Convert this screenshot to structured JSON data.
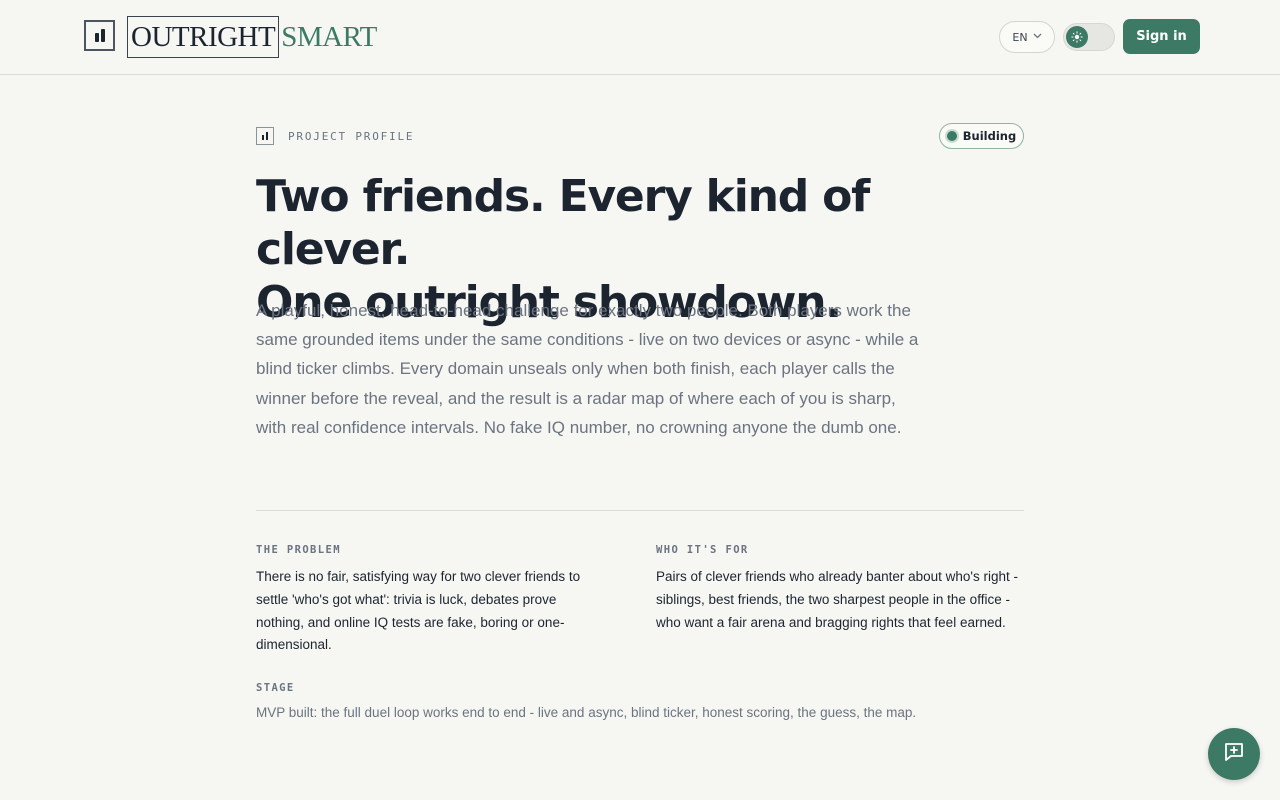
{
  "header": {
    "brand_part1_dark": "OUT",
    "brand_part1_mid": "RIGHT",
    "brand_part2": "SMART",
    "lang": "EN",
    "signin_label": "Sign in"
  },
  "profile": {
    "eyebrow": "PROJECT PROFILE",
    "status": "Building",
    "headline_line1": "Two friends. Every kind of clever.",
    "headline_line2": "One outright showdown.",
    "lede": "A playful, honest, head-to-head challenge for exactly two people. Both players work the same grounded items under the same conditions - live on two devices or async - while a blind ticker climbs. Every domain unseals only when both finish, each player calls the winner before the reveal, and the result is a radar map of where each of you is sharp, with real confidence intervals. No fake IQ number, no crowning anyone the dumb one.",
    "problem_title": "THE PROBLEM",
    "problem_text": "There is no fair, satisfying way for two clever friends to settle 'who's got what': trivia is luck, debates prove nothing, and online IQ tests are fake, boring or one-dimensional.",
    "who_title": "WHO IT'S FOR",
    "who_text": "Pairs of clever friends who already banter about who's right - siblings, best friends, the two sharpest people in the office - who want a fair arena and bragging rights that feel earned.",
    "stage_title": "STAGE",
    "stage_text": "MVP built: the full duel loop works end to end - live and async, blind ticker, honest scoring, the guess, the map."
  },
  "colors": {
    "accent": "#3d7a66",
    "background": "#f6f6f3",
    "text": "#1c2430",
    "muted": "#6b7480"
  },
  "icons": {
    "logo": "bar-chart-icon",
    "lang_chevron": "chevron-down-icon",
    "theme": "sun-icon",
    "fab": "feedback-plus-icon"
  }
}
